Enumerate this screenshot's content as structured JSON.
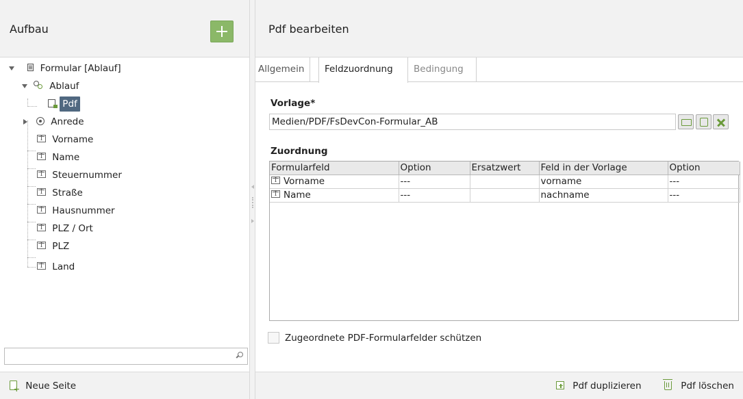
{
  "left_panel": {
    "title": "Aufbau",
    "add_icon": "plus-icon",
    "tree": {
      "root": {
        "label": "Formular [Ablauf]",
        "icon": "form-icon"
      },
      "ablauf": {
        "label": "Ablauf",
        "icon": "gears-icon"
      },
      "pdf": {
        "label": "Pdf",
        "icon": "pdf-page-icon"
      },
      "anrede": {
        "label": "Anrede",
        "icon": "radio-icon"
      },
      "fields": [
        {
          "label": "Vorname",
          "icon": "text-field-icon"
        },
        {
          "label": "Name",
          "icon": "text-field-icon"
        },
        {
          "label": "Steuernummer",
          "icon": "text-field-icon"
        },
        {
          "label": "Straße",
          "icon": "text-field-icon"
        },
        {
          "label": "Hausnummer",
          "icon": "text-field-icon"
        },
        {
          "label": "PLZ / Ort",
          "icon": "text-field-icon"
        },
        {
          "label": "PLZ",
          "icon": "text-field-icon"
        },
        {
          "label": "Land",
          "icon": "text-field-icon"
        }
      ]
    },
    "search": {
      "value": "",
      "icon": "search-icon"
    },
    "footer": {
      "new_page_label": "Neue Seite",
      "icon": "new-page-icon"
    }
  },
  "right_panel": {
    "title": "Pdf bearbeiten",
    "tabs": [
      {
        "label": "Allgemein",
        "active": false
      },
      {
        "label": "Feldzuordnung",
        "active": true
      },
      {
        "label": "Bedingung",
        "active": false
      }
    ],
    "vorlage": {
      "label": "Vorlage*",
      "value": "Medien/PDF/FsDevCon-Formular_AB"
    },
    "zuordnung": {
      "label": "Zuordnung",
      "columns": [
        "Formularfeld",
        "Option",
        "Ersatzwert",
        "Feld in der Vorlage",
        "Option"
      ],
      "rows": [
        [
          "Vorname",
          "---",
          "",
          "vorname",
          "---"
        ],
        [
          "Name",
          "---",
          "",
          "nachname",
          "---"
        ]
      ]
    },
    "protect_checkbox": {
      "label": "Zugeordnete PDF-Formularfelder schützen",
      "checked": false
    },
    "footer": {
      "duplicate_label": "Pdf duplizieren",
      "delete_label": "Pdf löschen"
    }
  },
  "colors": {
    "accent_green": "#8bb868",
    "selection": "#506880",
    "header_bg": "#f2f2f2"
  }
}
